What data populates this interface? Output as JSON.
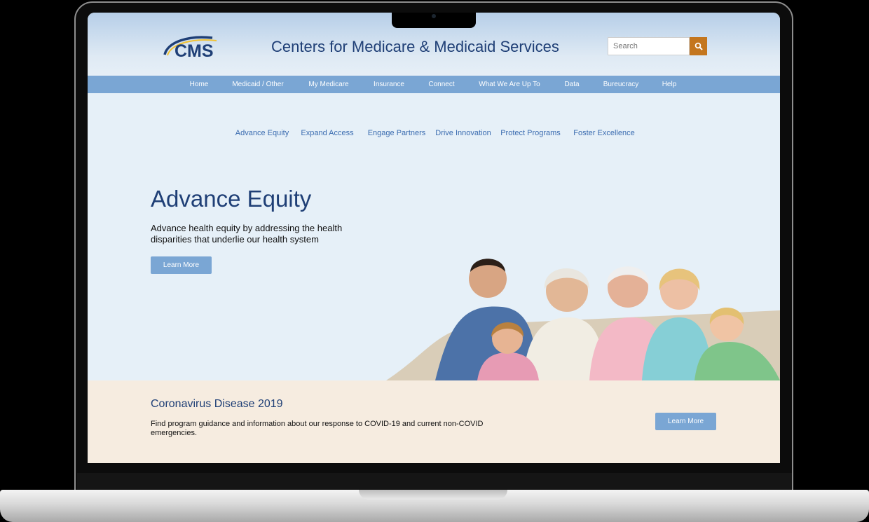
{
  "header": {
    "logo_text": "CMS",
    "site_title": "Centers for Medicare & Medicaid Services",
    "search_placeholder": "Search",
    "search_icon": "search-icon"
  },
  "nav": {
    "items": [
      "Home",
      "Medicaid / Other",
      "My Medicare",
      "Insurance",
      "Connect",
      "What We Are Up To",
      "Data",
      "Bureucracy",
      "Help"
    ]
  },
  "subnav": {
    "items": [
      "Advance Equity",
      "Expand Access",
      "Engage Partners",
      "Drive Innovation",
      "Protect Programs",
      "Foster Excellence"
    ]
  },
  "hero": {
    "title": "Advance Equity",
    "description": "Advance health equity by addressing the health disparities that underlie our health system",
    "button_label": "Learn More"
  },
  "covid": {
    "title": "Coronavirus Disease 2019",
    "description": "Find program guidance and information about our response to COVID-19 and current non-COVID emergencies.",
    "button_label": "Learn More"
  },
  "colors": {
    "brand_navy": "#1f3f76",
    "nav_blue": "#7aa6d4",
    "link_blue": "#3b6cb0",
    "search_orange": "#c4761e",
    "hero_bg": "#e6f0f8",
    "covid_bg": "#f6ece0"
  }
}
